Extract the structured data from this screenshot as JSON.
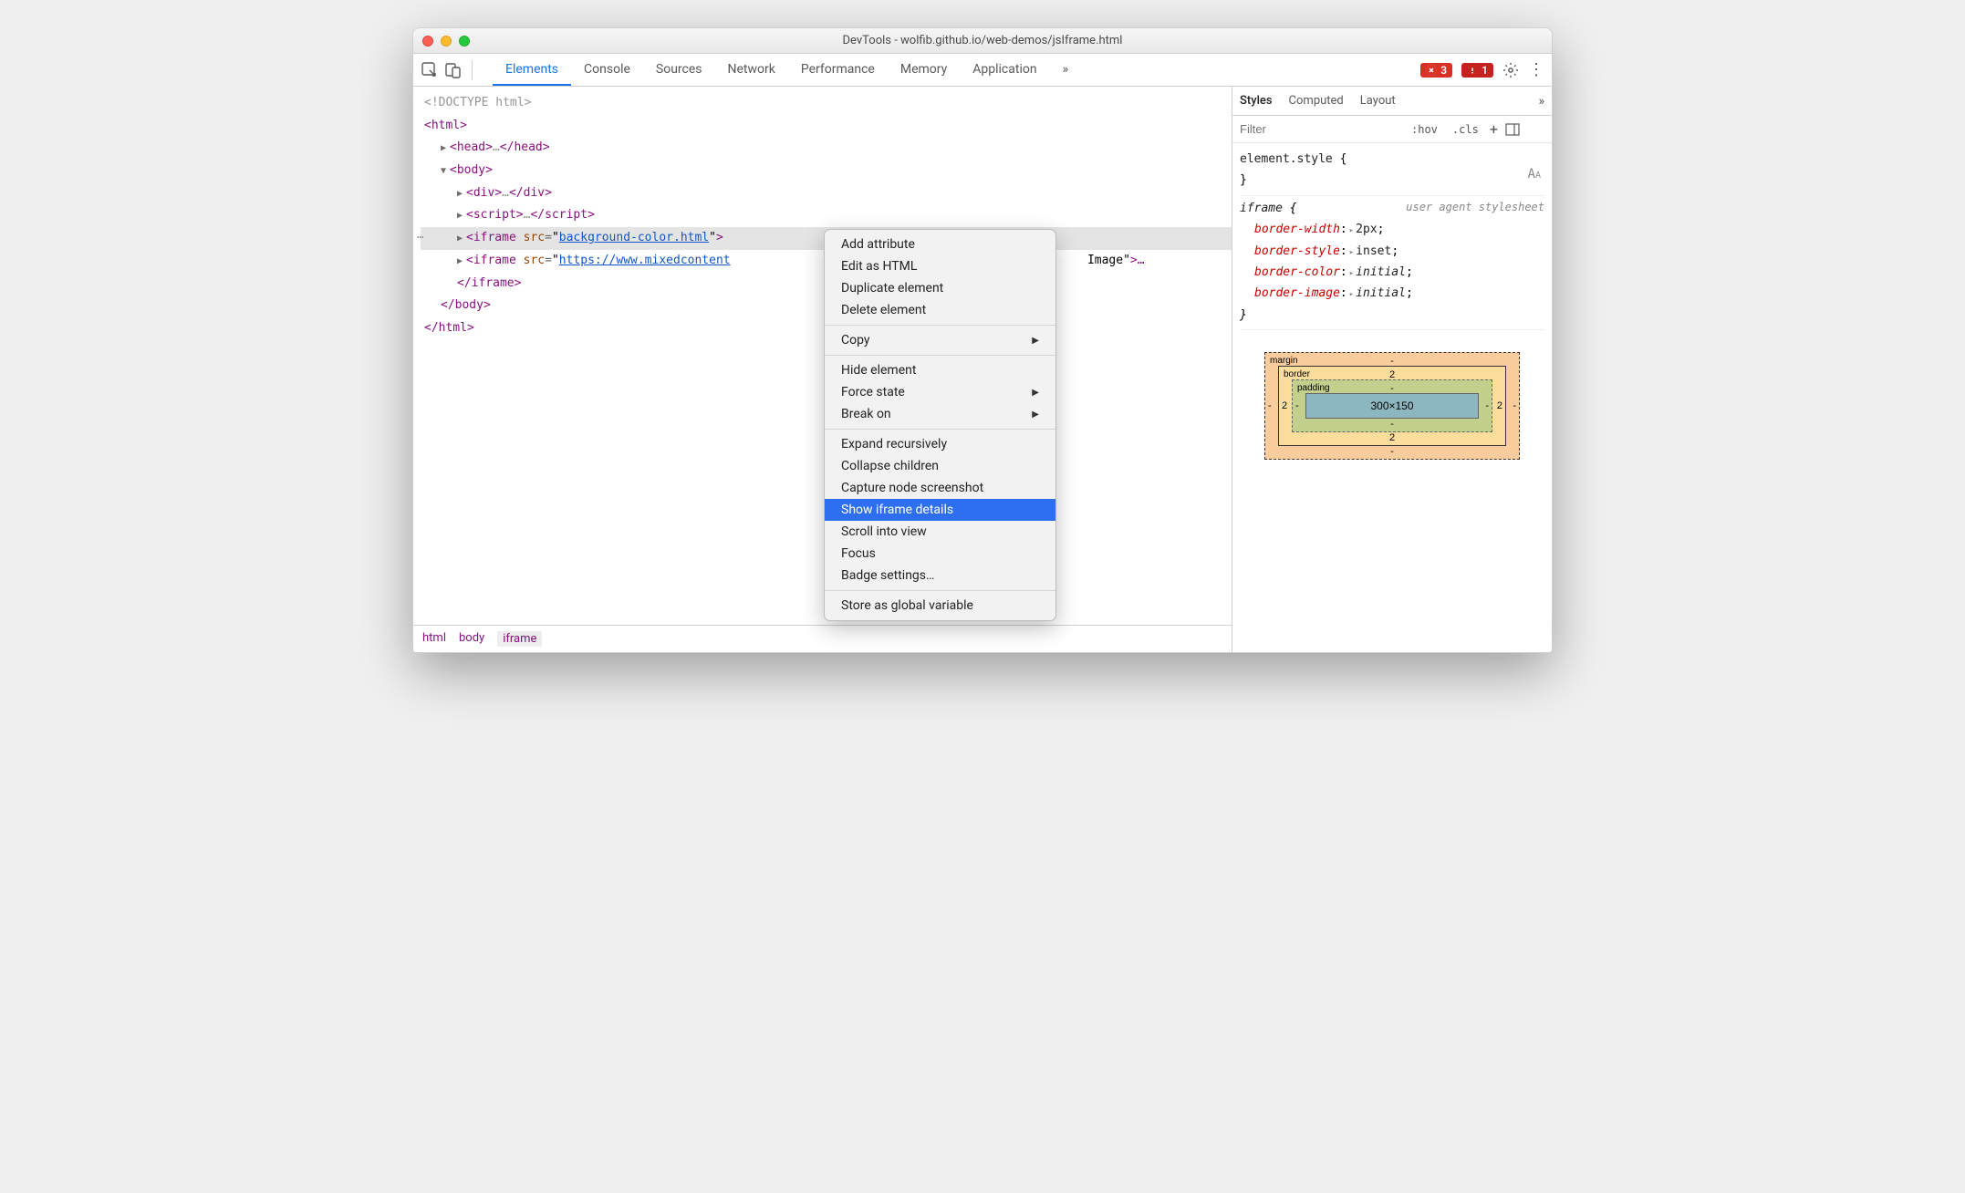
{
  "window": {
    "title": "DevTools - wolfib.github.io/web-demos/jsIframe.html"
  },
  "toolbar": {
    "tabs": [
      "Elements",
      "Console",
      "Sources",
      "Network",
      "Performance",
      "Memory",
      "Application"
    ],
    "active_tab": 0,
    "error_count": "3",
    "issue_count": "1"
  },
  "dom": {
    "doctype": "<!DOCTYPE html>",
    "html_open": "html",
    "head": {
      "open": "head",
      "ellipsis": "…",
      "close": "head"
    },
    "body_open": "body",
    "div": {
      "tag": "div",
      "ellipsis": "…"
    },
    "script": {
      "tag": "script",
      "ellipsis": "…"
    },
    "iframe1": {
      "tag": "iframe",
      "attr": "src",
      "value": "background-color.html",
      "after": ">"
    },
    "iframe2": {
      "tag": "iframe",
      "attr": "src",
      "value": "https://www.mixedcontent",
      "title_attr": "Image",
      "after": ">…"
    },
    "iframe2_close": "iframe",
    "body_close": "body",
    "html_close": "html"
  },
  "breadcrumb": [
    "html",
    "body",
    "iframe"
  ],
  "styles": {
    "tabs": [
      "Styles",
      "Computed",
      "Layout"
    ],
    "active_tab": 0,
    "filter_placeholder": "Filter",
    "hov": ":hov",
    "cls": ".cls",
    "rule1": {
      "selector": "element.style",
      "open": "{",
      "close": "}"
    },
    "rule2": {
      "selector": "iframe",
      "open": "{",
      "ua": "user agent stylesheet",
      "props": [
        {
          "name": "border-width",
          "value": "2px",
          "tri": true
        },
        {
          "name": "border-style",
          "value": "inset",
          "tri": true
        },
        {
          "name": "border-color",
          "value": "initial",
          "tri": true,
          "italic": true
        },
        {
          "name": "border-image",
          "value": "initial",
          "tri": true,
          "italic": true
        }
      ],
      "close": "}"
    }
  },
  "boxmodel": {
    "margin": {
      "label": "margin",
      "top": "-",
      "right": "-",
      "bottom": "-",
      "left": "-"
    },
    "border": {
      "label": "border",
      "top": "2",
      "right": "2",
      "bottom": "2",
      "left": "2"
    },
    "padding": {
      "label": "padding",
      "top": "-",
      "right": "-",
      "bottom": "-",
      "left": "-"
    },
    "content": "300×150"
  },
  "context_menu": {
    "items": [
      {
        "label": "Add attribute"
      },
      {
        "label": "Edit as HTML"
      },
      {
        "label": "Duplicate element"
      },
      {
        "label": "Delete element"
      },
      {
        "sep": true
      },
      {
        "label": "Copy",
        "submenu": true
      },
      {
        "sep": true
      },
      {
        "label": "Hide element"
      },
      {
        "label": "Force state",
        "submenu": true
      },
      {
        "label": "Break on",
        "submenu": true
      },
      {
        "sep": true
      },
      {
        "label": "Expand recursively"
      },
      {
        "label": "Collapse children"
      },
      {
        "label": "Capture node screenshot"
      },
      {
        "label": "Show iframe details",
        "highlight": true
      },
      {
        "label": "Scroll into view"
      },
      {
        "label": "Focus"
      },
      {
        "label": "Badge settings…"
      },
      {
        "sep": true
      },
      {
        "label": "Store as global variable"
      }
    ]
  }
}
